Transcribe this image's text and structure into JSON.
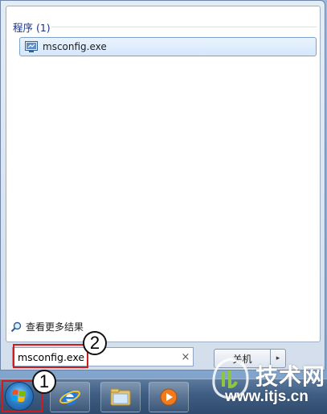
{
  "results": {
    "section_header": "程序 (1)",
    "items": [
      {
        "label": "msconfig.exe",
        "icon": "system-config-icon"
      }
    ],
    "see_more": "查看更多结果"
  },
  "search": {
    "value": "msconfig.exe",
    "clear": "×"
  },
  "shutdown": {
    "label": "关机",
    "arrow": "▸"
  },
  "annotations": {
    "step_1": "1",
    "step_2": "2",
    "highlight_color": "#d01c1c"
  },
  "taskbar": {
    "items": [
      {
        "name": "start-orb",
        "icon": "windows-logo-icon"
      },
      {
        "name": "internet-explorer",
        "icon": "ie-icon"
      },
      {
        "name": "windows-explorer",
        "icon": "folder-icon"
      },
      {
        "name": "media-player",
        "icon": "media-player-icon"
      }
    ]
  },
  "watermark": {
    "brand": "技术网",
    "url": "www.itjs.cn"
  }
}
